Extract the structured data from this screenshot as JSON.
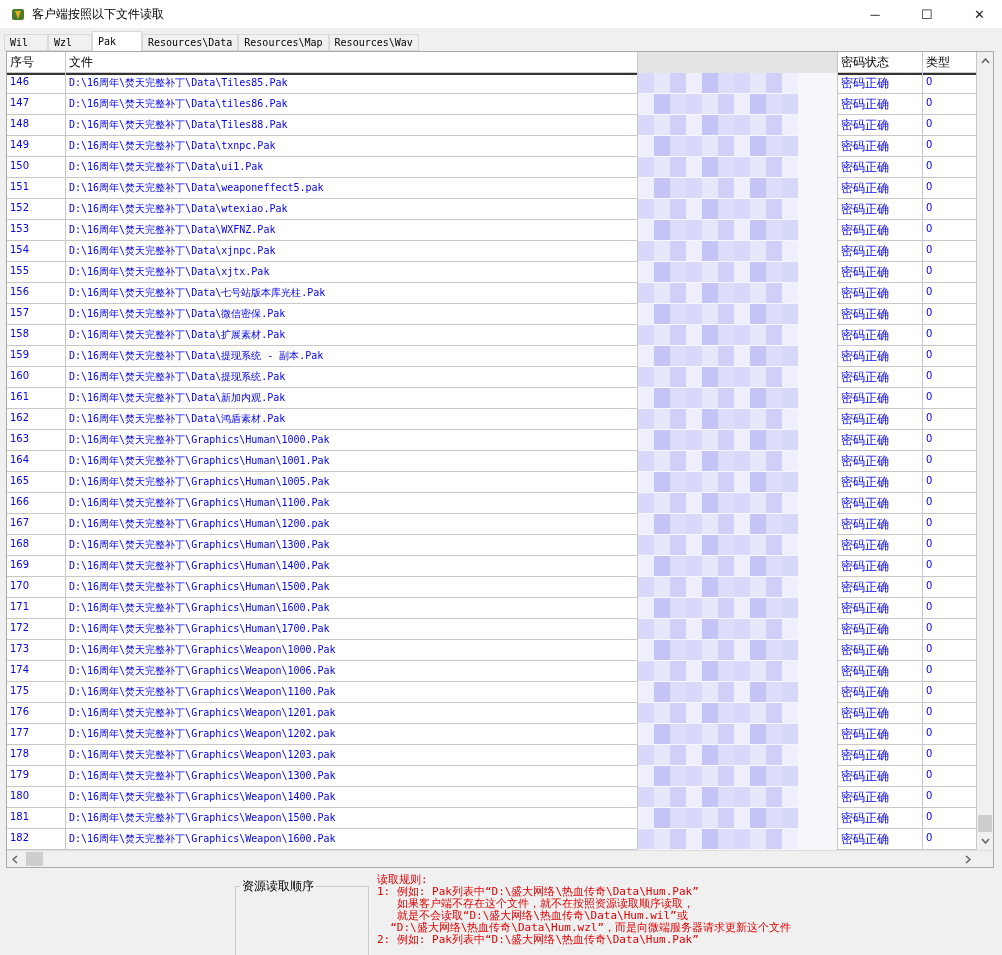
{
  "window": {
    "title": "客户端按照以下文件读取",
    "controls": [
      "─",
      "☐",
      "✕"
    ]
  },
  "tabs": [
    {
      "label": "Wil",
      "selected": false
    },
    {
      "label": "Wzl",
      "selected": false
    },
    {
      "label": "Pak",
      "selected": true
    },
    {
      "label": "Resources\\Data",
      "selected": false
    },
    {
      "label": "Resources\\Map",
      "selected": false
    },
    {
      "label": "Resources\\Wav",
      "selected": false
    }
  ],
  "table": {
    "columns": [
      "序号",
      "文件",
      "密码状态",
      "类型"
    ],
    "rows": [
      {
        "no": "146",
        "file": "D:\\16周年\\焚天完整补丁\\Data\\Tiles85.Pak",
        "status": "密码正确",
        "type": "0"
      },
      {
        "no": "147",
        "file": "D:\\16周年\\焚天完整补丁\\Data\\tiles86.Pak",
        "status": "密码正确",
        "type": "0"
      },
      {
        "no": "148",
        "file": "D:\\16周年\\焚天完整补丁\\Data\\Tiles88.Pak",
        "status": "密码正确",
        "type": "0"
      },
      {
        "no": "149",
        "file": "D:\\16周年\\焚天完整补丁\\Data\\txnpc.Pak",
        "status": "密码正确",
        "type": "0"
      },
      {
        "no": "150",
        "file": "D:\\16周年\\焚天完整补丁\\Data\\ui1.Pak",
        "status": "密码正确",
        "type": "0"
      },
      {
        "no": "151",
        "file": "D:\\16周年\\焚天完整补丁\\Data\\weaponeffect5.pak",
        "status": "密码正确",
        "type": "0"
      },
      {
        "no": "152",
        "file": "D:\\16周年\\焚天完整补丁\\Data\\wtexiao.Pak",
        "status": "密码正确",
        "type": "0"
      },
      {
        "no": "153",
        "file": "D:\\16周年\\焚天完整补丁\\Data\\WXFNZ.Pak",
        "status": "密码正确",
        "type": "0"
      },
      {
        "no": "154",
        "file": "D:\\16周年\\焚天完整补丁\\Data\\xjnpc.Pak",
        "status": "密码正确",
        "type": "0"
      },
      {
        "no": "155",
        "file": "D:\\16周年\\焚天完整补丁\\Data\\xjtx.Pak",
        "status": "密码正确",
        "type": "0"
      },
      {
        "no": "156",
        "file": "D:\\16周年\\焚天完整补丁\\Data\\七号站版本库光柱.Pak",
        "status": "密码正确",
        "type": "0"
      },
      {
        "no": "157",
        "file": "D:\\16周年\\焚天完整补丁\\Data\\微信密保.Pak",
        "status": "密码正确",
        "type": "0"
      },
      {
        "no": "158",
        "file": "D:\\16周年\\焚天完整补丁\\Data\\扩展素材.Pak",
        "status": "密码正确",
        "type": "0"
      },
      {
        "no": "159",
        "file": "D:\\16周年\\焚天完整补丁\\Data\\提现系统 - 副本.Pak",
        "status": "密码正确",
        "type": "0"
      },
      {
        "no": "160",
        "file": "D:\\16周年\\焚天完整补丁\\Data\\提现系统.Pak",
        "status": "密码正确",
        "type": "0"
      },
      {
        "no": "161",
        "file": "D:\\16周年\\焚天完整补丁\\Data\\新加内观.Pak",
        "status": "密码正确",
        "type": "0"
      },
      {
        "no": "162",
        "file": "D:\\16周年\\焚天完整补丁\\Data\\鸿盾素材.Pak",
        "status": "密码正确",
        "type": "0"
      },
      {
        "no": "163",
        "file": "D:\\16周年\\焚天完整补丁\\Graphics\\Human\\1000.Pak",
        "status": "密码正确",
        "type": "0"
      },
      {
        "no": "164",
        "file": "D:\\16周年\\焚天完整补丁\\Graphics\\Human\\1001.Pak",
        "status": "密码正确",
        "type": "0"
      },
      {
        "no": "165",
        "file": "D:\\16周年\\焚天完整补丁\\Graphics\\Human\\1005.Pak",
        "status": "密码正确",
        "type": "0"
      },
      {
        "no": "166",
        "file": "D:\\16周年\\焚天完整补丁\\Graphics\\Human\\1100.Pak",
        "status": "密码正确",
        "type": "0"
      },
      {
        "no": "167",
        "file": "D:\\16周年\\焚天完整补丁\\Graphics\\Human\\1200.pak",
        "status": "密码正确",
        "type": "0"
      },
      {
        "no": "168",
        "file": "D:\\16周年\\焚天完整补丁\\Graphics\\Human\\1300.Pak",
        "status": "密码正确",
        "type": "0"
      },
      {
        "no": "169",
        "file": "D:\\16周年\\焚天完整补丁\\Graphics\\Human\\1400.Pak",
        "status": "密码正确",
        "type": "0"
      },
      {
        "no": "170",
        "file": "D:\\16周年\\焚天完整补丁\\Graphics\\Human\\1500.Pak",
        "status": "密码正确",
        "type": "0"
      },
      {
        "no": "171",
        "file": "D:\\16周年\\焚天完整补丁\\Graphics\\Human\\1600.Pak",
        "status": "密码正确",
        "type": "0"
      },
      {
        "no": "172",
        "file": "D:\\16周年\\焚天完整补丁\\Graphics\\Human\\1700.Pak",
        "status": "密码正确",
        "type": "0"
      },
      {
        "no": "173",
        "file": "D:\\16周年\\焚天完整补丁\\Graphics\\Weapon\\1000.Pak",
        "status": "密码正确",
        "type": "0"
      },
      {
        "no": "174",
        "file": "D:\\16周年\\焚天完整补丁\\Graphics\\Weapon\\1006.Pak",
        "status": "密码正确",
        "type": "0"
      },
      {
        "no": "175",
        "file": "D:\\16周年\\焚天完整补丁\\Graphics\\Weapon\\1100.Pak",
        "status": "密码正确",
        "type": "0"
      },
      {
        "no": "176",
        "file": "D:\\16周年\\焚天完整补丁\\Graphics\\Weapon\\1201.pak",
        "status": "密码正确",
        "type": "0"
      },
      {
        "no": "177",
        "file": "D:\\16周年\\焚天完整补丁\\Graphics\\Weapon\\1202.pak",
        "status": "密码正确",
        "type": "0"
      },
      {
        "no": "178",
        "file": "D:\\16周年\\焚天完整补丁\\Graphics\\Weapon\\1203.pak",
        "status": "密码正确",
        "type": "0"
      },
      {
        "no": "179",
        "file": "D:\\16周年\\焚天完整补丁\\Graphics\\Weapon\\1300.Pak",
        "status": "密码正确",
        "type": "0"
      },
      {
        "no": "180",
        "file": "D:\\16周年\\焚天完整补丁\\Graphics\\Weapon\\1400.Pak",
        "status": "密码正确",
        "type": "0"
      },
      {
        "no": "181",
        "file": "D:\\16周年\\焚天完整补丁\\Graphics\\Weapon\\1500.Pak",
        "status": "密码正确",
        "type": "0"
      },
      {
        "no": "182",
        "file": "D:\\16周年\\焚天完整补丁\\Graphics\\Weapon\\1600.Pak",
        "status": "密码正确",
        "type": "0"
      }
    ]
  },
  "order_group": {
    "title": "资源读取顺序"
  },
  "rules": [
    "读取规则:",
    "1: 例如: Pak列表中“D:\\盛大网络\\热血传奇\\Data\\Hum.Pak”",
    "   如果客户端不存在这个文件，就不在按照资源读取顺序读取，",
    "   就是不会读取“D:\\盛大网络\\热血传奇\\Data\\Hum.wil”或",
    "  “D:\\盛大网络\\热血传奇\\Data\\Hum.wzl”，而是向微端服务器请求更新这个文件",
    "2: 例如: Pak列表中“D:\\盛大网络\\热血传奇\\Data\\Hum.Pak”"
  ]
}
